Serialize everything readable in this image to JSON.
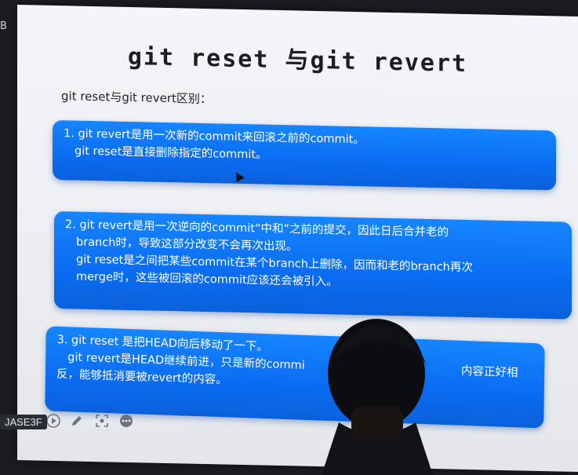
{
  "left_edge": {
    "label": "B"
  },
  "slide": {
    "title": "git reset 与git revert",
    "subtitle": "git reset与git revert区别：",
    "boxes": [
      {
        "lines": [
          "1. git revert是用一次新的commit来回滚之前的commit。",
          "git reset是直接删除指定的commit。"
        ]
      },
      {
        "lines": [
          "2. git revert是用一次逆向的commit“中和”之前的提交，因此日后合并老的",
          "branch时，导致这部分改变不会再次出现。",
          "git reset是之间把某些commit在某个branch上删除，因而和老的branch再次",
          "merge时，这些被回滚的commit应该还会被引入。"
        ]
      },
      {
        "lines": [
          "3. git reset 是把HEAD向后移动了一下。",
          "git revert是HEAD继续前进，只是新的commi",
          "内容正好相",
          "反，能够抵消要被revert的内容。"
        ]
      }
    ]
  },
  "overlay": {
    "badge": "JASE3F",
    "toolbar_icons": [
      "play-icon",
      "pen-icon",
      "screenshot-icon",
      "more-icon"
    ]
  },
  "colors": {
    "box_blue": "#0a6cf2",
    "slide_bg": "#eceef2",
    "frame_bg": "#1b1d22"
  }
}
